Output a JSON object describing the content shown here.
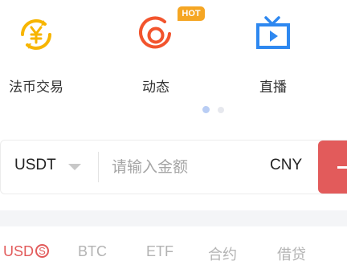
{
  "quick_actions": [
    {
      "label": "法币交易",
      "icon": "yuan-exchange-icon"
    },
    {
      "label": "动态",
      "icon": "activity-swirl-icon"
    },
    {
      "label": "直播",
      "icon": "tv-play-icon"
    }
  ],
  "hot_badge": "HOT",
  "pager": {
    "count": 2,
    "active": 1
  },
  "converter": {
    "coin": "USDT",
    "placeholder": "请输入金额",
    "fiat": "CNY"
  },
  "tabs": [
    {
      "label": "USD",
      "active": true
    },
    {
      "label": "BTC",
      "active": false
    },
    {
      "label": "ETF",
      "active": false
    },
    {
      "label": "合约",
      "active": false
    },
    {
      "label": "借贷",
      "active": false
    }
  ],
  "tab_usd_symbol": "S",
  "colors": {
    "accent": "#e25b5b",
    "yellow": "#f7b500",
    "orange": "#f2542d",
    "blue": "#2e88f0"
  }
}
